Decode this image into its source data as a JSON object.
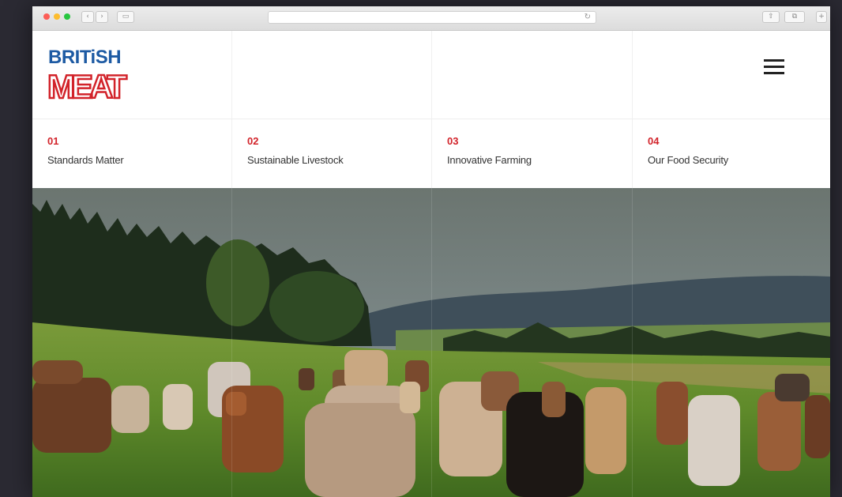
{
  "browser": {
    "back_glyph": "‹",
    "forward_glyph": "›",
    "sidebar_glyph": "▭",
    "reload_glyph": "↻",
    "share_glyph": "⇧",
    "tabs_glyph": "⧉",
    "plus_glyph": "+"
  },
  "brand": {
    "line1": "BRITiSH",
    "line2": "MEAT",
    "colors": {
      "blue": "#1d5aa3",
      "red": "#d2232a"
    }
  },
  "menu": {
    "icon": "hamburger-menu-icon"
  },
  "nav": {
    "items": [
      {
        "number": "01",
        "label": "Standards Matter"
      },
      {
        "number": "02",
        "label": "Sustainable Livestock"
      },
      {
        "number": "03",
        "label": "Innovative Farming"
      },
      {
        "number": "04",
        "label": "Our Food Security"
      }
    ]
  }
}
